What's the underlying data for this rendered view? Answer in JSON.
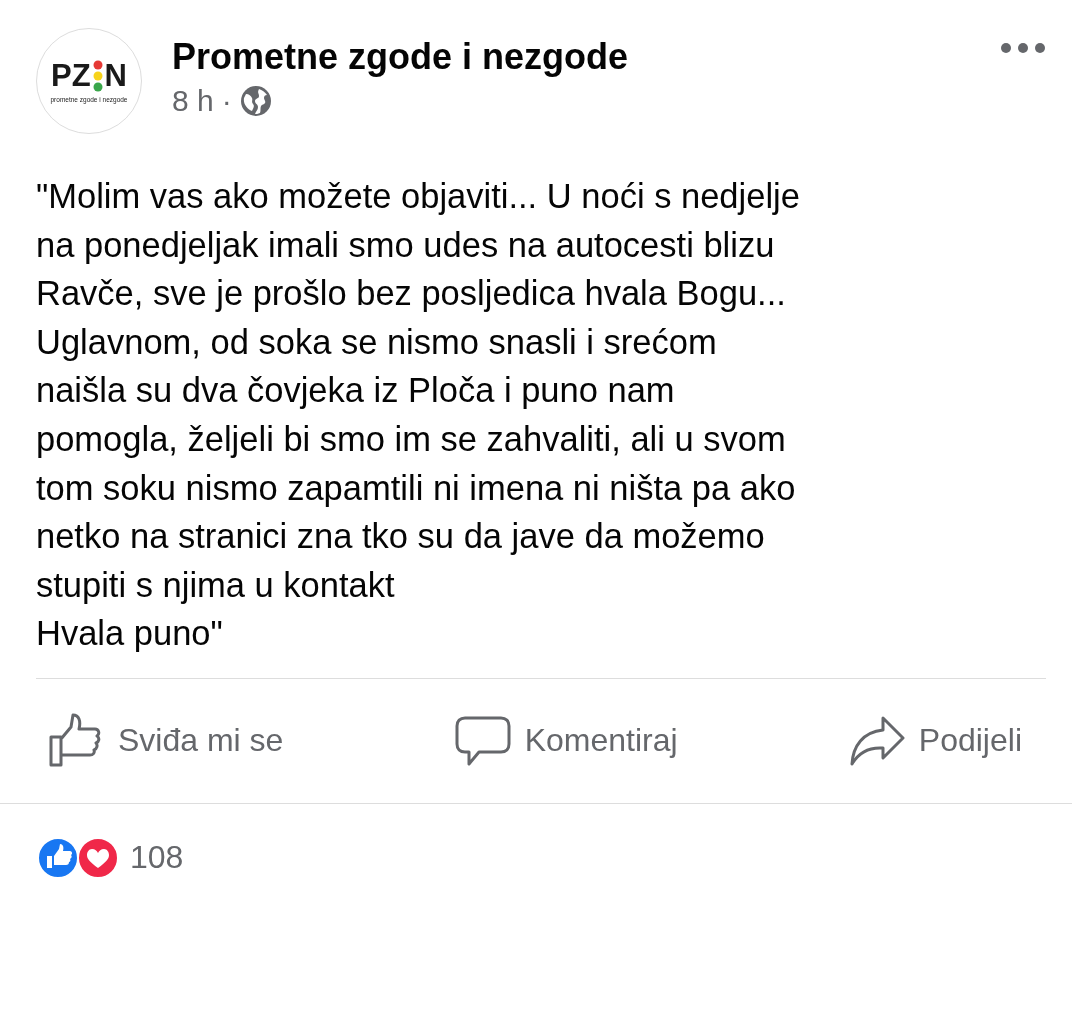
{
  "post": {
    "logo": {
      "left": "PZ",
      "right": "N",
      "tagline": "prometne zgode i nezgode"
    },
    "author": "Prometne zgode i nezgode",
    "time": "8 h",
    "separator": "·",
    "body_lines": [
      "\"Molim vas ako možete objaviti... U noći s nedjelje",
      "na ponedjeljak imali smo udes na autocesti blizu",
      "Ravče, sve je prošlo bez posljedica hvala Bogu...",
      "Uglavnom, od soka se nismo snasli i srećom",
      "naišla su dva čovjeka iz Ploča i puno nam",
      "pomogla, željeli bi smo im se zahvaliti, ali u svom",
      "tom soku nismo zapamtili ni imena ni ništa pa ako",
      "netko na stranici zna tko su da jave da možemo",
      "stupiti s njima u kontakt",
      "Hvala puno\""
    ]
  },
  "actions": [
    {
      "kind": "like",
      "label": "Sviđa mi se"
    },
    {
      "kind": "comment",
      "label": "Komentiraj"
    },
    {
      "kind": "share",
      "label": "Podijeli"
    }
  ],
  "reactions": {
    "icons": [
      {
        "kind": "like"
      },
      {
        "kind": "love"
      }
    ],
    "count": "108"
  }
}
